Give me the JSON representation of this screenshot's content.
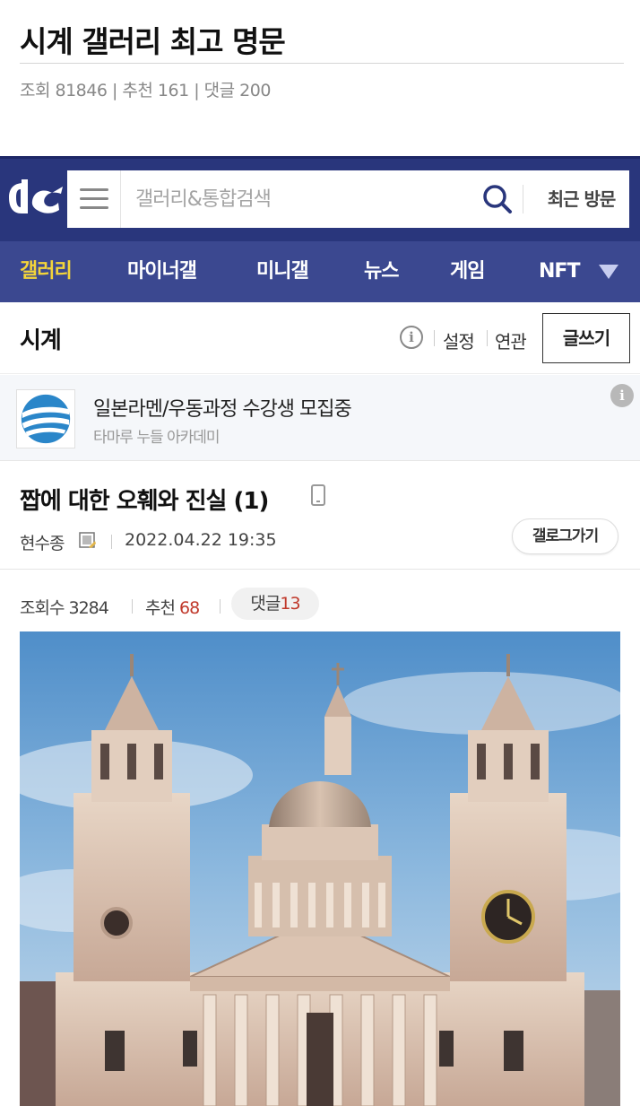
{
  "post": {
    "title": "시계 갤러리 최고 명문",
    "meta": "조회 81846 | 추천 161 | 댓글 200"
  },
  "header": {
    "logo": "dc",
    "search_placeholder": "갤러리&통합검색",
    "recent_visit": "최근 방문"
  },
  "nav": {
    "items": [
      "갤러리",
      "마이너갤",
      "미니갤",
      "뉴스",
      "게임",
      "NFT"
    ],
    "active_index": 0
  },
  "gallery": {
    "name": "시계",
    "info": "i",
    "settings": "설정",
    "related": "연관",
    "write": "글쓰기"
  },
  "ad": {
    "title": "일본라멘/우동과정 수강생 모집중",
    "subtitle": "타마루 누들 아카데미",
    "info": "i"
  },
  "article": {
    "title": "짭에 대한 오훼와 진실 (1)",
    "author": "현수종",
    "date": "2022.04.22 19:35",
    "gallog_button": "갤로그가기"
  },
  "stats": {
    "views_label": "조회수",
    "views": "3284",
    "recommend_label": "추천",
    "recommend": "68",
    "comments_label": "댓글",
    "comments": "13"
  },
  "colors": {
    "header_bg": "#29367c",
    "nav_bg": "#3b4890",
    "nav_active": "#f3d43a",
    "count_red": "#c0392b"
  }
}
